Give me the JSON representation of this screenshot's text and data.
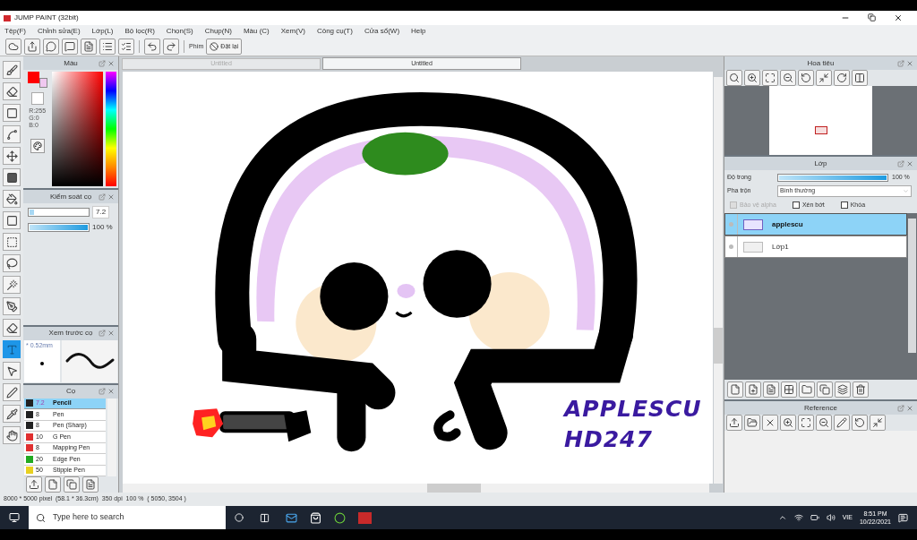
{
  "window": {
    "title": "JUMP PAINT (32bit)"
  },
  "menu": [
    "Tệp(F)",
    "Chỉnh sửa(E)",
    "Lớp(L)",
    "Bộ lọc(R)",
    "Chọn(S)",
    "Chụp(N)",
    "Màu (C)",
    "Xem(V)",
    "Công cụ(T)",
    "Cửa sổ(W)",
    "Help"
  ],
  "toolbar": {
    "shortcut_label": "Phím",
    "reset_button": "Đặt lại"
  },
  "tools": [
    {
      "kind": "brush",
      "selected": false
    },
    {
      "kind": "eraser",
      "selected": false
    },
    {
      "kind": "rect",
      "selected": false
    },
    {
      "kind": "polyline",
      "selected": false
    },
    {
      "kind": "move",
      "selected": false
    },
    {
      "kind": "fill",
      "selected": false
    },
    {
      "kind": "bucket",
      "selected": false
    },
    {
      "kind": "gradient",
      "selected": false
    },
    {
      "kind": "select",
      "selected": false
    },
    {
      "kind": "lasso",
      "selected": false
    },
    {
      "kind": "wand",
      "selected": false
    },
    {
      "kind": "selpen",
      "selected": false
    },
    {
      "kind": "seleraser",
      "selected": false
    },
    {
      "kind": "text",
      "selected": true
    },
    {
      "kind": "pointer",
      "selected": false
    },
    {
      "kind": "pen",
      "selected": false
    },
    {
      "kind": "dropper",
      "selected": false
    },
    {
      "kind": "hand",
      "selected": false
    }
  ],
  "color_panel": {
    "title": "Màu",
    "rgb": [
      "R:255",
      "G:0",
      "B:0"
    ]
  },
  "brush_control": {
    "title": "Kiểm soát cọ",
    "size": {
      "level": 0.08,
      "reading": "7.2"
    },
    "opacity": {
      "level": 1,
      "reading": "100 %"
    }
  },
  "brush_preview": {
    "title": "Xem trước cọ",
    "size": "* 0.52mm"
  },
  "brushes": {
    "title": "Cọ",
    "items": [
      {
        "size": "7.2",
        "name": "Pencil",
        "color": "#222222",
        "selected": true
      },
      {
        "size": "8",
        "name": "Pen",
        "color": "#222222",
        "selected": false
      },
      {
        "size": "8",
        "name": "Pen (Sharp)",
        "color": "#222222",
        "selected": false
      },
      {
        "size": "10",
        "name": "G Pen",
        "color": "#e03030",
        "selected": false
      },
      {
        "size": "8",
        "name": "Mapping Pen",
        "color": "#e03030",
        "selected": false
      },
      {
        "size": "20",
        "name": "Edge Pen",
        "color": "#22aa22",
        "selected": false
      },
      {
        "size": "50",
        "name": "Stipple Pen",
        "color": "#e8d020",
        "selected": false
      }
    ]
  },
  "document_tabs": [
    {
      "label": "Untitled",
      "selected": false
    },
    {
      "label": "Untitled",
      "selected": true
    }
  ],
  "canvas": {
    "artwork_text": [
      "APPLESCU",
      "HD247"
    ]
  },
  "navigator": {
    "title": "Hoa tiêu"
  },
  "layers": {
    "title": "Lớp",
    "opacity_label": "Độ trong",
    "opacity": {
      "level": 1,
      "reading": "100 %"
    },
    "blend_label": "Pha trộn",
    "blend_value": "Bình thường",
    "options": [
      {
        "label": "Bảo vệ alpha",
        "checked": false,
        "disabled": true
      },
      {
        "label": "Xén bớt",
        "checked": false,
        "disabled": false
      },
      {
        "label": "Khóa",
        "checked": false,
        "disabled": false
      }
    ],
    "items": [
      {
        "name": "applescu",
        "selected": true
      },
      {
        "name": "Lớp1",
        "selected": false
      }
    ]
  },
  "reference": {
    "title": "Reference"
  },
  "status_bar": "8000 * 5000 pixel  (58.1 * 36.3cm)  350 dpi  100 %  ( 5050, 3504 )",
  "taskbar": {
    "search_placeholder": "Type here to search",
    "language": "VIE",
    "time": "8:51 PM",
    "date": "10/22/2021"
  }
}
